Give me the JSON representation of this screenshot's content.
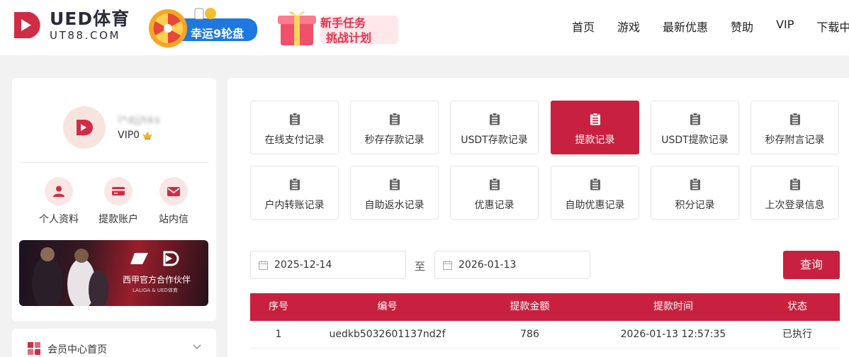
{
  "header": {
    "logo_title": "UED体育",
    "logo_sub": "UT88.COM",
    "promo_wheel": "幸运9轮盘",
    "promo_task_line1": "新手任务",
    "promo_task_line2": "挑战计划",
    "nav": [
      "首页",
      "游戏",
      "最新优惠",
      "赞助",
      "VIP",
      "下载中心"
    ]
  },
  "sidebar": {
    "username": "l*djjhks",
    "vip_level": "VIP0",
    "quick_links": [
      {
        "label": "个人资料",
        "icon": "user-icon"
      },
      {
        "label": "提款账户",
        "icon": "card-icon"
      },
      {
        "label": "站内信",
        "icon": "mail-icon"
      }
    ],
    "banner_title": "西甲官方合作伙伴",
    "banner_sub": "LALIGA & UED体育",
    "menu_item": "会员中心首页"
  },
  "records": {
    "tiles": [
      "在线支付记录",
      "秒存存款记录",
      "USDT存款记录",
      "提款记录",
      "USDT提款记录",
      "秒存附言记录",
      "户内转账记录",
      "自助返水记录",
      "优惠记录",
      "自助优惠记录",
      "积分记录",
      "上次登录信息"
    ],
    "active_tile": "提款记录"
  },
  "filter": {
    "start_date": "2025-12-14",
    "to_label": "至",
    "end_date": "2026-01-13",
    "query_label": "查询"
  },
  "table": {
    "headers": [
      "序号",
      "编号",
      "提款金额",
      "提款时间",
      "状态"
    ],
    "rows": [
      [
        "1",
        "uedkb5032601137nd2f",
        "786",
        "2026-01-13 12:57:35",
        "已执行"
      ]
    ]
  },
  "colors": {
    "accent": "#c8213f",
    "accent_light": "#fbe6e6"
  }
}
